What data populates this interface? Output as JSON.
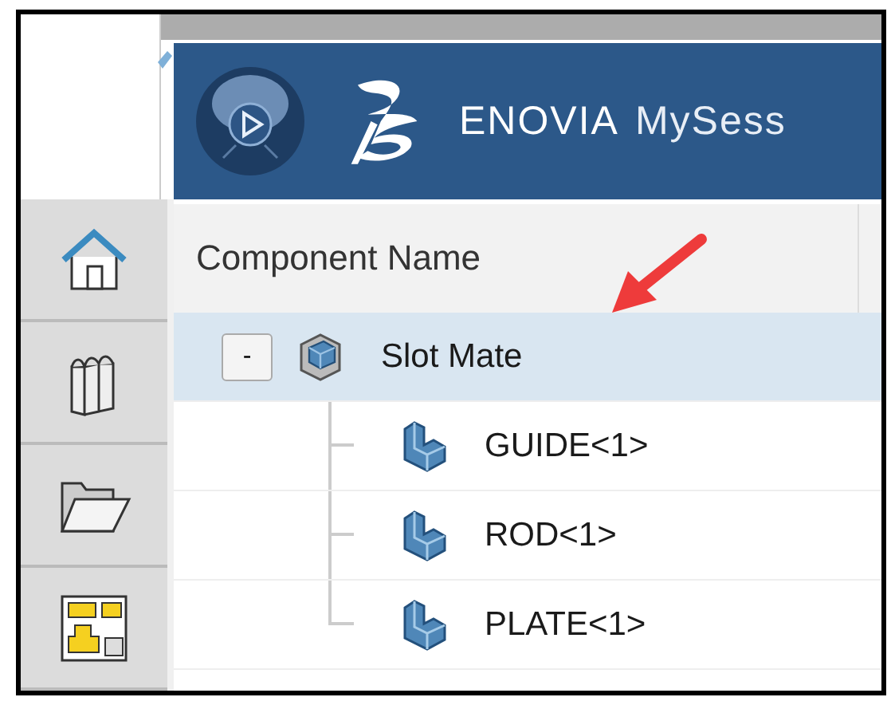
{
  "header": {
    "app": "ENOVIA",
    "title": "MySess"
  },
  "sidebar": {
    "items": [
      {
        "kind": "home"
      },
      {
        "kind": "books"
      },
      {
        "kind": "folder"
      },
      {
        "kind": "layout"
      }
    ]
  },
  "table": {
    "columns": [
      "Component Name"
    ],
    "rows": [
      {
        "name": "Slot Mate",
        "kind": "assembly",
        "toggle": "-",
        "selected": true,
        "children": [
          {
            "name": "GUIDE<1>",
            "kind": "part",
            "selected": false
          },
          {
            "name": "ROD<1>",
            "kind": "part",
            "selected": false
          },
          {
            "name": "PLATE<1>",
            "kind": "part",
            "selected": false
          }
        ]
      }
    ]
  },
  "annotation": {
    "kind": "arrow"
  }
}
